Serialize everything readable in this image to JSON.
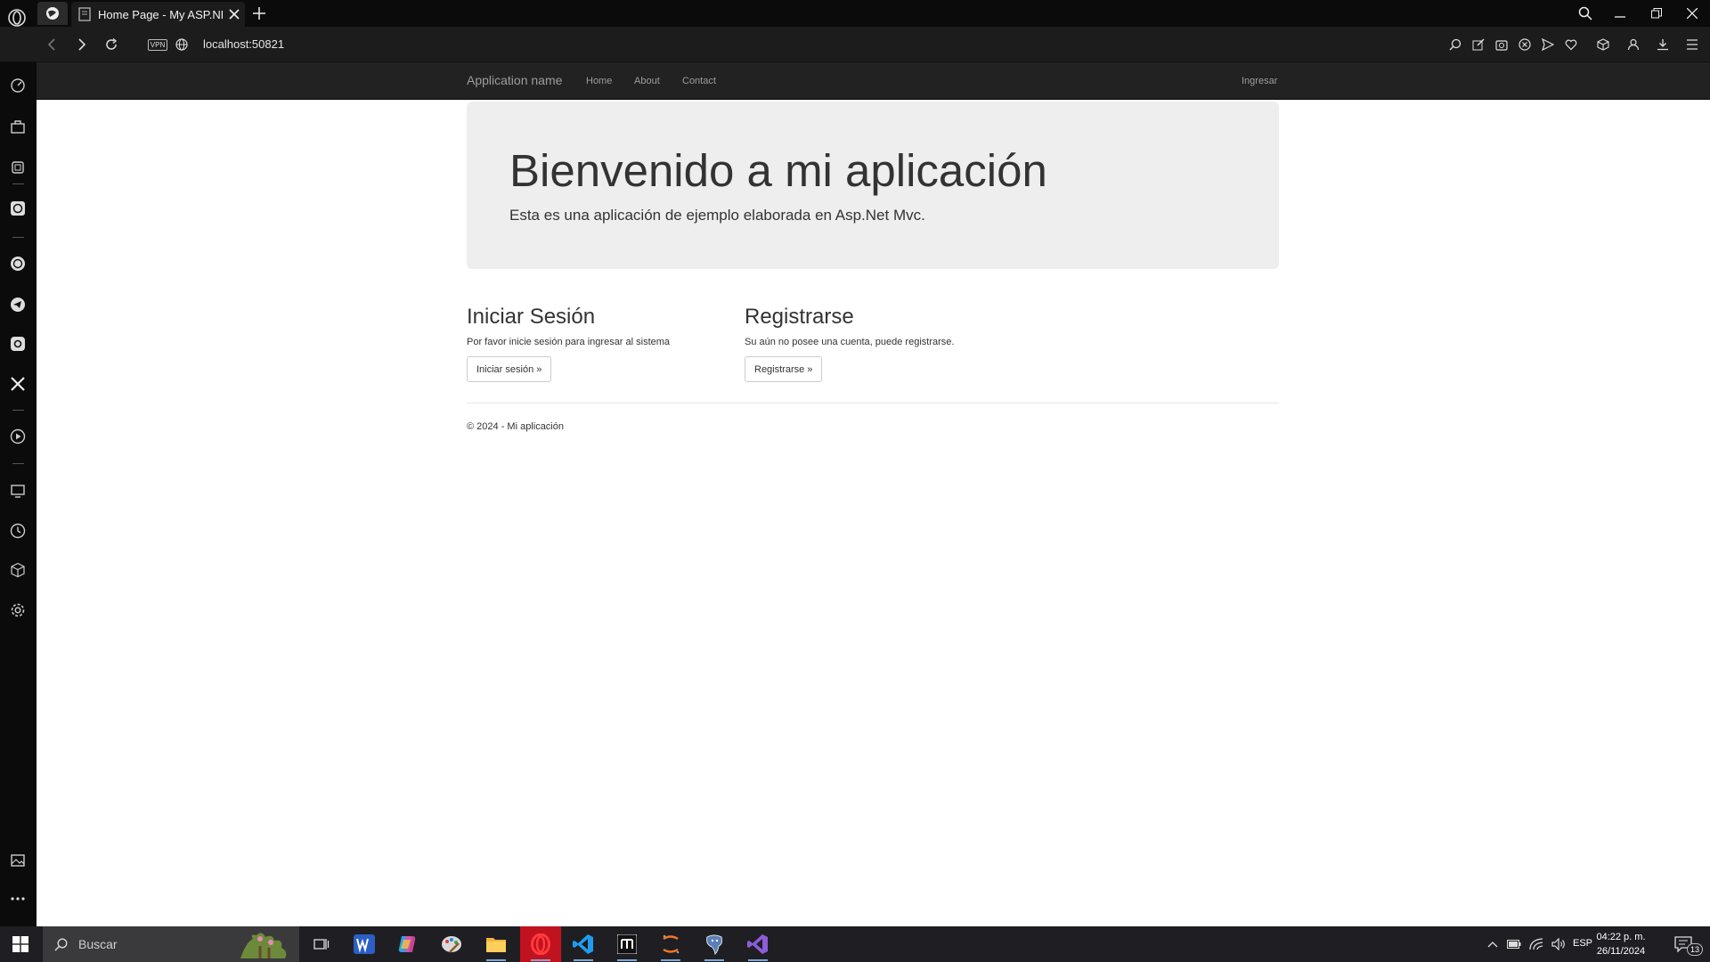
{
  "browser": {
    "tab_title": "Home Page - My ASP.NET /",
    "url": "localhost:50821",
    "vpn_label": "VPN"
  },
  "site": {
    "brand": "Application name",
    "nav": [
      "Home",
      "About",
      "Contact"
    ],
    "login_link": "Ingresar",
    "hero_title": "Bienvenido a mi aplicación",
    "hero_lead": "Esta es una aplicación de ejemplo elaborada en Asp.Net Mvc.",
    "login": {
      "heading": "Iniciar Sesión",
      "text": "Por favor inicie sesión para ingresar al sistema",
      "button": "Iniciar sesión »"
    },
    "register": {
      "heading": "Registrarse",
      "text": "Su aún no posee una cuenta, puede registrarse.",
      "button": "Registrarse »"
    },
    "footer": "© 2024 - Mi aplicación"
  },
  "taskbar": {
    "search_placeholder": "Buscar",
    "language": "ESP",
    "time": "04:22 p. m.",
    "date": "26/11/2024",
    "notification_count": "13"
  },
  "colors": {
    "navbar": "#222222",
    "jumbotron": "#eeeeee",
    "taskbar": "#1f1f23"
  }
}
